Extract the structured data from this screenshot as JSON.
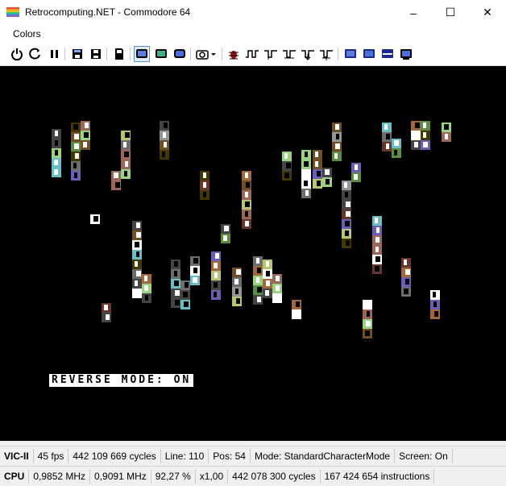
{
  "window": {
    "title": "Retrocomputing.NET - Commodore 64"
  },
  "menu": {
    "items": [
      "Colors"
    ]
  },
  "toolbar": {
    "buttons": [
      "power-icon",
      "reset-icon",
      "pause-icon",
      "save-state-icon",
      "load-state-icon",
      "sd-card-icon",
      "monitor-blue-icon",
      "monitor-green-icon",
      "monitor-crt-icon",
      "camera-icon",
      "bug-icon",
      "waveform-1-icon",
      "waveform-2-icon",
      "waveform-3-icon",
      "waveform-4-icon",
      "waveform-5-icon",
      "display-1-icon",
      "display-2-icon",
      "display-3-icon",
      "display-4-icon"
    ]
  },
  "screen": {
    "message": "REVERSE MODE: ON"
  },
  "status_vic": {
    "label": "VIC-II",
    "fps": "45 fps",
    "cycles": "442 109 669 cycles",
    "line": "Line: 110",
    "pos": "Pos: 54",
    "mode": "Mode: StandardCharacterMode",
    "screen": "Screen: On"
  },
  "status_cpu": {
    "label": "CPU",
    "mhz1": "0,9852 MHz",
    "mhz2": "0,9091 MHz",
    "percent": "92,27 %",
    "speed": "x1,00",
    "cycles": "442 078 300 cycles",
    "instructions": "167 424 654 instructions"
  },
  "colors": {
    "c64_screen": "#000000",
    "accent": "#3b5bd1"
  }
}
